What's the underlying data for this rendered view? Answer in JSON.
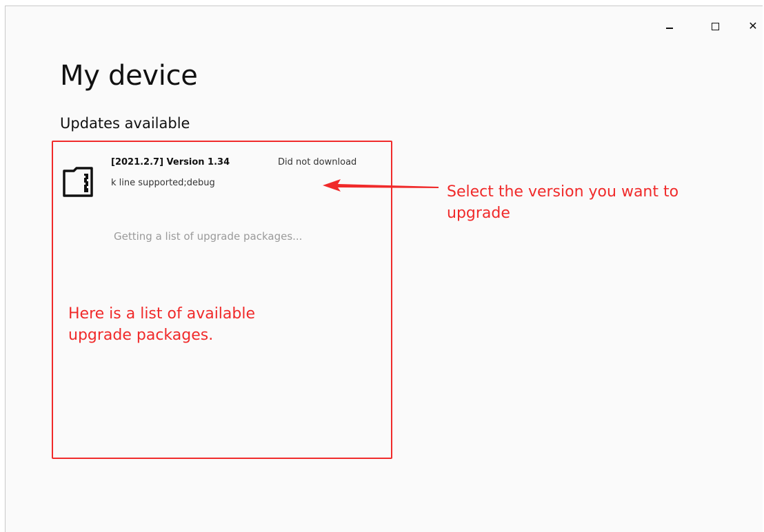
{
  "window_controls": {
    "minimize": "minimize-icon",
    "maximize": "maximize-icon",
    "close": "close-icon",
    "close_glyph": "✕"
  },
  "page": {
    "title": "My device",
    "section_title": "Updates available"
  },
  "packages": [
    {
      "title": "[2021.2.7] Version 1.34",
      "status": "Did not download",
      "description": "k line supported;debug",
      "icon": "sd-card-icon"
    }
  ],
  "loading_text": "Getting a list of upgrade packages...",
  "annotations": {
    "list_note": "Here is a list of available upgrade packages.",
    "select_note": "Select the version you want to upgrade",
    "color": "#f02a2a"
  }
}
